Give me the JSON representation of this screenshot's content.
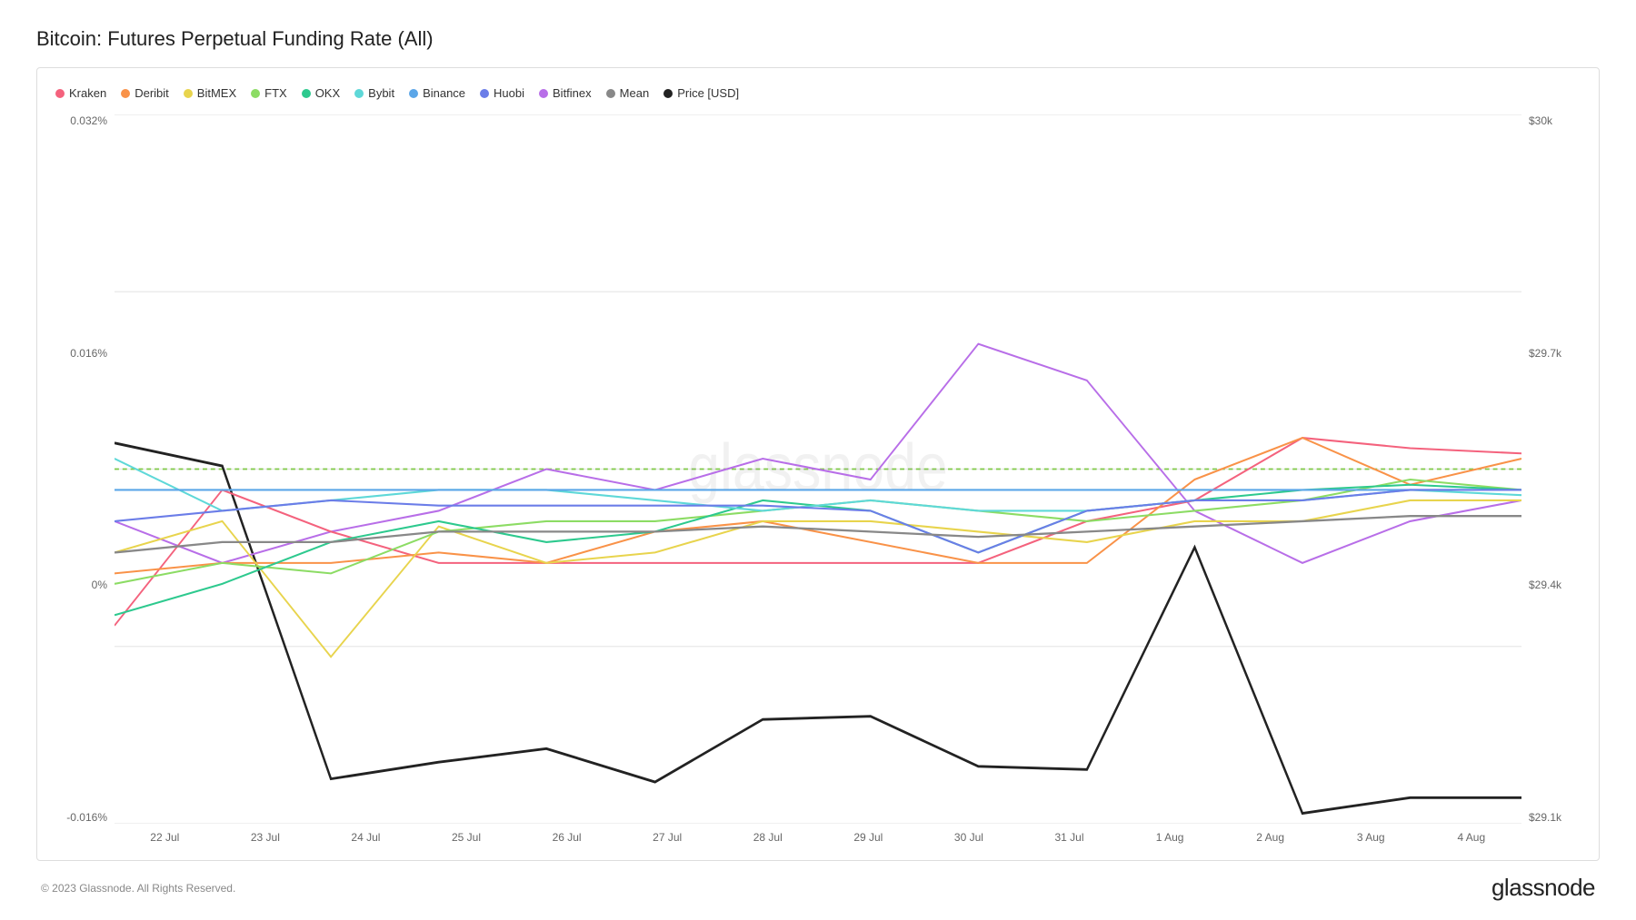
{
  "page": {
    "title": "Bitcoin: Futures Perpetual Funding Rate (All)",
    "footer_copyright": "© 2023 Glassnode. All Rights Reserved.",
    "footer_logo": "glassnode"
  },
  "legend": {
    "items": [
      {
        "label": "Kraken",
        "color": "#f4627d"
      },
      {
        "label": "Deribit",
        "color": "#f99248"
      },
      {
        "label": "BitMEX",
        "color": "#e8d44d"
      },
      {
        "label": "FTX",
        "color": "#8cdc64"
      },
      {
        "label": "OKX",
        "color": "#2dc98e"
      },
      {
        "label": "Bybit",
        "color": "#5ed8d8"
      },
      {
        "label": "Binance",
        "color": "#5ba6e8"
      },
      {
        "label": "Huobi",
        "color": "#6b7de8"
      },
      {
        "label": "Bitfinex",
        "color": "#b86ee8"
      },
      {
        "label": "Mean",
        "color": "#888888"
      },
      {
        "label": "Price [USD]",
        "color": "#222222"
      }
    ]
  },
  "yaxis_left": {
    "labels": [
      "0.032%",
      "0.016%",
      "0%",
      "-0.016%"
    ]
  },
  "yaxis_right": {
    "labels": [
      "$30k",
      "$29.7k",
      "$29.4k",
      "$29.1k"
    ]
  },
  "xaxis": {
    "labels": [
      "22 Jul",
      "23 Jul",
      "24 Jul",
      "25 Jul",
      "26 Jul",
      "27 Jul",
      "28 Jul",
      "29 Jul",
      "30 Jul",
      "31 Jul",
      "1 Aug",
      "2 Aug",
      "3 Aug",
      "4 Aug"
    ]
  },
  "watermark": "glassnode"
}
